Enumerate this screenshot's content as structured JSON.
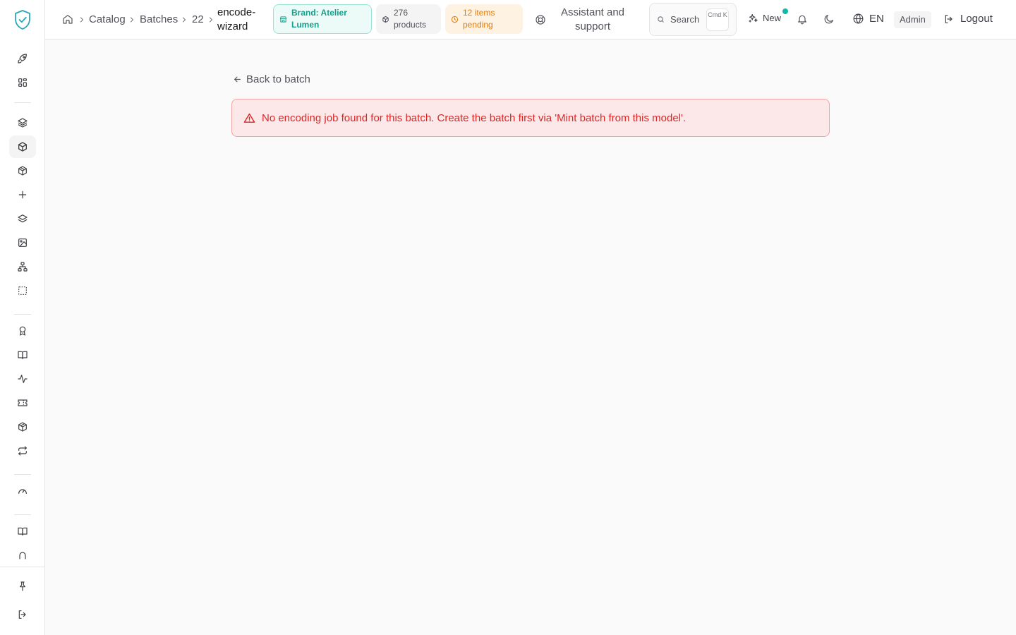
{
  "breadcrumb": {
    "items": [
      "Catalog",
      "Batches",
      "22"
    ],
    "current": "encode-wizard"
  },
  "header": {
    "brand_pill": "Brand: Atelier Lumen",
    "products_pill": "276 products",
    "pending_pill": "12 items pending",
    "assistant_label": "Assistant and support",
    "search_label": "Search",
    "search_kbd": "Cmd K",
    "new_label": "New",
    "language": "EN",
    "role_badge": "Admin",
    "logout_label": "Logout"
  },
  "main": {
    "back_link": "Back to batch",
    "alert_message": "No encoding job found for this batch. Create the batch first via 'Mint batch from this model'."
  },
  "colors": {
    "accent": "#14b8a6",
    "brand_pill_text": "#16a08a",
    "pending_text": "#e07b10",
    "alert_text": "#dc2626",
    "alert_bg": "#fce8e8"
  },
  "icons": {
    "sidebar": [
      "rocket-icon",
      "dashboard-icon",
      "layers-icon",
      "box-icon",
      "package-icon",
      "plus-icon",
      "stack-icon",
      "image-icon",
      "hierarchy-icon",
      "dashed-square-icon",
      "award-icon",
      "book-icon",
      "activity-icon",
      "ticket-icon",
      "box-check-icon",
      "repeat-icon",
      "gauge-icon",
      "book-open-icon",
      "arch-icon",
      "pin-icon",
      "sign-out-icon"
    ]
  }
}
